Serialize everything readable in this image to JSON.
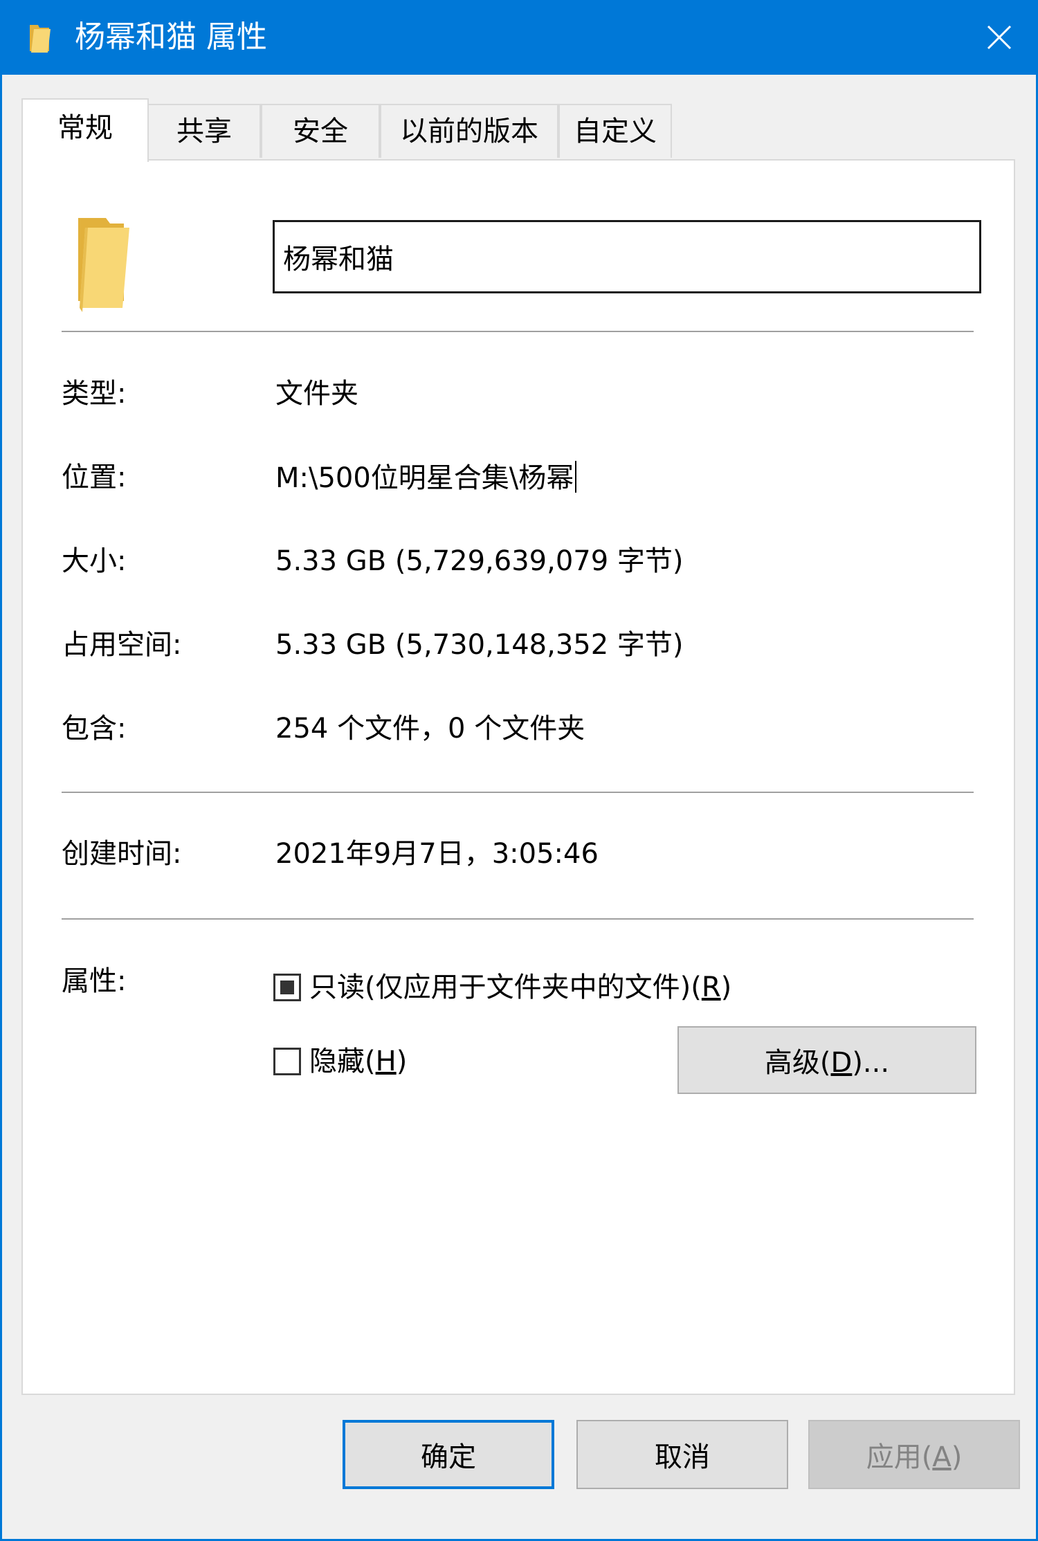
{
  "window": {
    "title": "杨幂和猫 属性",
    "close_glyph": "✕"
  },
  "tabs": [
    {
      "label": "常规",
      "active": true
    },
    {
      "label": "共享",
      "active": false
    },
    {
      "label": "安全",
      "active": false
    },
    {
      "label": "以前的版本",
      "active": false
    },
    {
      "label": "自定义",
      "active": false
    }
  ],
  "general": {
    "folder_name": "杨幂和猫",
    "type_label": "类型:",
    "type_value": "文件夹",
    "location_label": "位置:",
    "location_value": "M:\\500位明星合集\\杨幂",
    "size_label": "大小:",
    "size_value": "5.33 GB (5,729,639,079 字节)",
    "disk_size_label": "占用空间:",
    "disk_size_value": "5.33 GB (5,730,148,352 字节)",
    "contains_label": "包含:",
    "contains_value": "254 个文件，0 个文件夹",
    "created_label": "创建时间:",
    "created_value": "2021年9月7日，3:05:46",
    "attributes_label": "属性:",
    "readonly_text": "只读(仅应用于文件夹中的文件)(",
    "readonly_key": "R",
    "readonly_close": ")",
    "readonly_state": "indeterminate",
    "hidden_text": "隐藏(",
    "hidden_key": "H",
    "hidden_close": ")",
    "hidden_checked": false,
    "advanced_text": "高级(",
    "advanced_key": "D",
    "advanced_close": ")..."
  },
  "footer": {
    "ok_label": "确定",
    "cancel_label": "取消",
    "apply_text": "应用(",
    "apply_key": "A",
    "apply_close": ")",
    "apply_enabled": false
  },
  "colors": {
    "titlebar": "#0078d7",
    "default_button_border": "#0078d7",
    "folder_yellow": "#f3cf6b"
  }
}
